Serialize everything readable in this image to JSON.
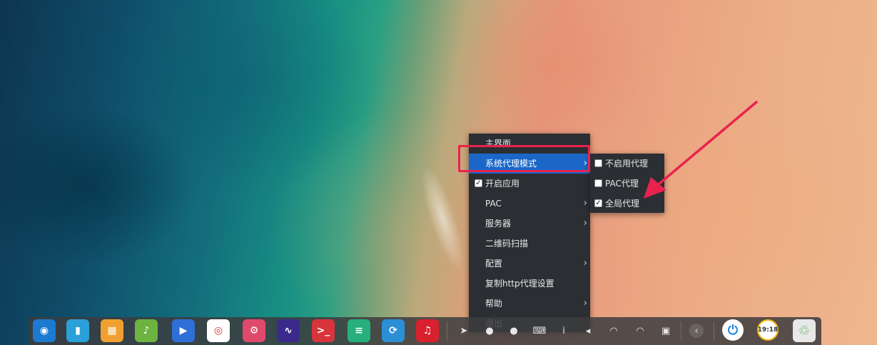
{
  "main_menu": {
    "items": [
      {
        "label": "主界面",
        "has_submenu": false,
        "checkbox": null,
        "highlighted": false
      },
      {
        "label": "系统代理模式",
        "has_submenu": true,
        "checkbox": null,
        "highlighted": true
      },
      {
        "label": "开启应用",
        "has_submenu": false,
        "checkbox": true,
        "highlighted": false
      },
      {
        "label": "PAC",
        "has_submenu": true,
        "checkbox": null,
        "highlighted": false
      },
      {
        "label": "服务器",
        "has_submenu": true,
        "checkbox": null,
        "highlighted": false
      },
      {
        "label": "二维码扫描",
        "has_submenu": false,
        "checkbox": null,
        "highlighted": false
      },
      {
        "label": "配置",
        "has_submenu": true,
        "checkbox": null,
        "highlighted": false
      },
      {
        "label": "复制http代理设置",
        "has_submenu": false,
        "checkbox": null,
        "highlighted": false
      },
      {
        "label": "帮助",
        "has_submenu": true,
        "checkbox": null,
        "highlighted": false
      },
      {
        "label": "退出",
        "has_submenu": false,
        "checkbox": null,
        "highlighted": false
      }
    ],
    "submenu_arrow": "›"
  },
  "proxy_submenu": {
    "items": [
      {
        "label": "不启用代理",
        "checked": false
      },
      {
        "label": "PAC代理",
        "checked": false
      },
      {
        "label": "全局代理",
        "checked": true
      }
    ]
  },
  "checkmark": "✓",
  "annotation": {
    "box_color": "#e8234e",
    "arrow_color": "#e8234e"
  },
  "dock": {
    "apps": [
      {
        "name": "launcher-icon",
        "color": "#1c7ad1",
        "glyph": "◉"
      },
      {
        "name": "file-manager-icon",
        "color": "#2aa1d8",
        "glyph": "▮"
      },
      {
        "name": "app-store-icon",
        "color": "#f0a030",
        "glyph": "▦"
      },
      {
        "name": "music-player-icon",
        "color": "#6cb33f",
        "glyph": "♪"
      },
      {
        "name": "video-player-icon",
        "color": "#2f6fd8",
        "glyph": "▶"
      },
      {
        "name": "chrome-icon",
        "color": "#ffffff",
        "glyph": "◎"
      },
      {
        "name": "settings-icon",
        "color": "#e04a6a",
        "glyph": "⚙"
      },
      {
        "name": "system-monitor-icon",
        "color": "#3b2a8c",
        "glyph": "∿"
      },
      {
        "name": "terminal-icon",
        "color": "#d8343c",
        "glyph": ">_"
      },
      {
        "name": "text-editor-icon",
        "color": "#27b07e",
        "glyph": "≡"
      },
      {
        "name": "network-app-icon",
        "color": "#2b8fd6",
        "glyph": "⟳"
      },
      {
        "name": "netease-music-icon",
        "color": "#d9202e",
        "glyph": "♫"
      }
    ],
    "tray": [
      {
        "name": "shadowsocks-tray-icon",
        "glyph": "➤"
      },
      {
        "name": "wechat-tray-icon",
        "glyph": "●"
      },
      {
        "name": "netease-tray-icon",
        "glyph": "●"
      },
      {
        "name": "keyboard-tray-icon",
        "glyph": "⌨"
      },
      {
        "name": "input-tray-icon",
        "glyph": "i"
      },
      {
        "name": "volume-tray-icon",
        "glyph": "◂"
      },
      {
        "name": "wifi-weak-tray-icon",
        "glyph": "◠"
      },
      {
        "name": "wifi-tray-icon",
        "glyph": "◠"
      },
      {
        "name": "battery-tray-icon",
        "glyph": "▣"
      },
      {
        "name": "collapse-tray-icon",
        "glyph": "‹"
      }
    ],
    "shutdown_glyph": "⏻",
    "clock_text": "19:18",
    "trash_glyph": "♲"
  }
}
